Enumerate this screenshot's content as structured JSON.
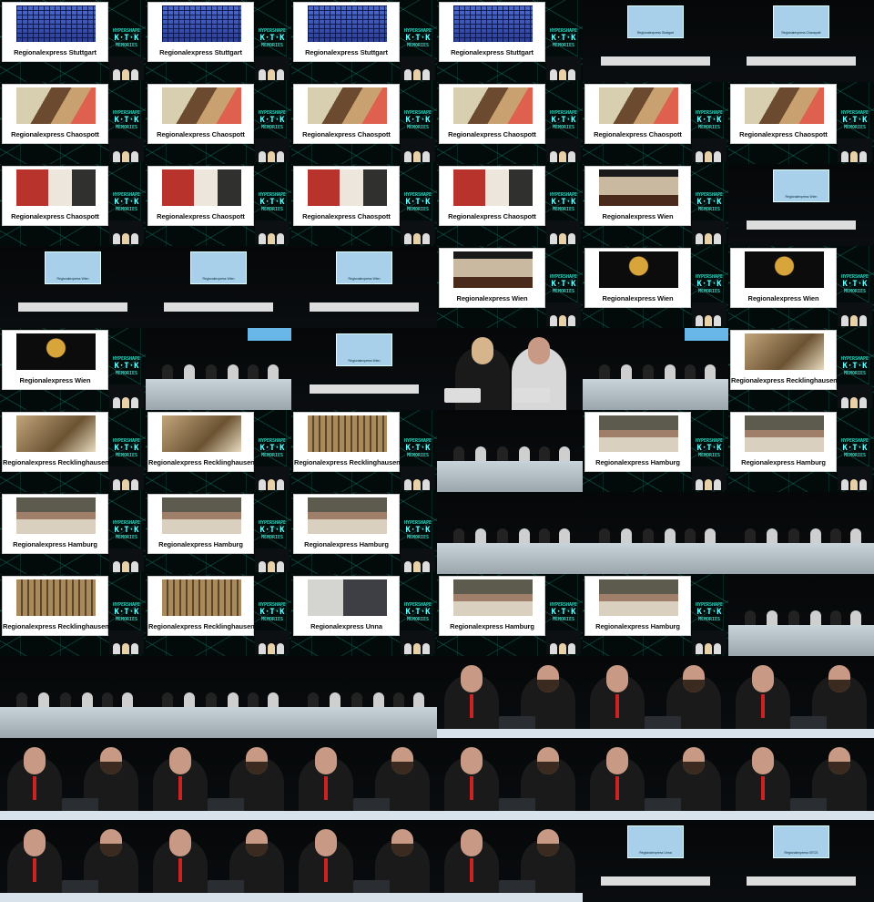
{
  "tiles": [
    {
      "type": "slide",
      "caption": "Regionalexpress Stuttgart",
      "pic": "building"
    },
    {
      "type": "slide",
      "caption": "Regionalexpress Stuttgart",
      "pic": "building"
    },
    {
      "type": "slide",
      "caption": "Regionalexpress Stuttgart",
      "pic": "building"
    },
    {
      "type": "slide",
      "caption": "Regionalexpress Stuttgart",
      "pic": "building"
    },
    {
      "type": "screen",
      "caption": "Regionalexpress Stuttgart"
    },
    {
      "type": "screen",
      "caption": "Regionalexpress Chaospott"
    },
    {
      "type": "slide",
      "caption": "Regionalexpress Chaospott",
      "pic": "desk"
    },
    {
      "type": "slide",
      "caption": "Regionalexpress Chaospott",
      "pic": "desk"
    },
    {
      "type": "slide",
      "caption": "Regionalexpress Chaospott",
      "pic": "desk"
    },
    {
      "type": "slide",
      "caption": "Regionalexpress Chaospott",
      "pic": "desk"
    },
    {
      "type": "slide",
      "caption": "Regionalexpress Chaospott",
      "pic": "desk"
    },
    {
      "type": "slide",
      "caption": "Regionalexpress Chaospott",
      "pic": "desk"
    },
    {
      "type": "slide",
      "caption": "Regionalexpress Chaospott",
      "pic": "hack"
    },
    {
      "type": "slide",
      "caption": "Regionalexpress Chaospott",
      "pic": "hack"
    },
    {
      "type": "slide",
      "caption": "Regionalexpress Chaospott",
      "pic": "hack"
    },
    {
      "type": "slide",
      "caption": "Regionalexpress Chaospott",
      "pic": "hack"
    },
    {
      "type": "slide",
      "caption": "Regionalexpress Wien",
      "pic": "hall"
    },
    {
      "type": "screen",
      "caption": "Regionalexpress Wien"
    },
    {
      "type": "screen",
      "caption": "Regionalexpress Wien"
    },
    {
      "type": "screen",
      "caption": "Regionalexpress Wien"
    },
    {
      "type": "screen",
      "caption": "Regionalexpress Wien"
    },
    {
      "type": "slide",
      "caption": "Regionalexpress Wien",
      "pic": "hall"
    },
    {
      "type": "slide",
      "caption": "Regionalexpress Wien",
      "pic": "gold"
    },
    {
      "type": "slide",
      "caption": "Regionalexpress Wien",
      "pic": "gold"
    },
    {
      "type": "slide",
      "caption": "Regionalexpress Wien",
      "pic": "gold"
    },
    {
      "type": "stage"
    },
    {
      "type": "screen",
      "caption": "Regionalexpress Wien"
    },
    {
      "type": "duo"
    },
    {
      "type": "stage"
    },
    {
      "type": "slide",
      "caption": "Regionalexpress Recklinghausen",
      "pic": "lab"
    },
    {
      "type": "slide",
      "caption": "Regionalexpress Recklinghausen",
      "pic": "lab"
    },
    {
      "type": "slide",
      "caption": "Regionalexpress Recklinghausen",
      "pic": "lab"
    },
    {
      "type": "slide",
      "caption": "Regionalexpress Recklinghausen",
      "pic": "shelf"
    },
    {
      "type": "stage"
    },
    {
      "type": "slide",
      "caption": "Regionalexpress Hamburg",
      "pic": "hamburg"
    },
    {
      "type": "slide",
      "caption": "Regionalexpress Hamburg",
      "pic": "hamburg"
    },
    {
      "type": "slide",
      "caption": "Regionalexpress Hamburg",
      "pic": "hamburg"
    },
    {
      "type": "slide",
      "caption": "Regionalexpress Hamburg",
      "pic": "hamburg"
    },
    {
      "type": "slide",
      "caption": "Regionalexpress Hamburg",
      "pic": "hamburg"
    },
    {
      "type": "stage"
    },
    {
      "type": "stage"
    },
    {
      "type": "stage"
    },
    {
      "type": "slide",
      "caption": "Regionalexpress Recklinghausen",
      "pic": "shelf"
    },
    {
      "type": "slide",
      "caption": "Regionalexpress Recklinghausen",
      "pic": "shelf"
    },
    {
      "type": "slide",
      "caption": "Regionalexpress Unna",
      "pic": "unna"
    },
    {
      "type": "slide",
      "caption": "Regionalexpress Hamburg",
      "pic": "hamburg"
    },
    {
      "type": "slide",
      "caption": "Regionalexpress Hamburg",
      "pic": "hamburg"
    },
    {
      "type": "stage"
    },
    {
      "type": "stage"
    },
    {
      "type": "stage"
    },
    {
      "type": "stage"
    },
    {
      "type": "closeup"
    },
    {
      "type": "closeup"
    },
    {
      "type": "closeup"
    },
    {
      "type": "closeup"
    },
    {
      "type": "closeup"
    },
    {
      "type": "closeup"
    },
    {
      "type": "closeup"
    },
    {
      "type": "closeup"
    },
    {
      "type": "closeup"
    },
    {
      "type": "closeup"
    },
    {
      "type": "closeup"
    },
    {
      "type": "closeup"
    },
    {
      "type": "closeup"
    },
    {
      "type": "screen",
      "caption": "Regionalexpress Unna"
    },
    {
      "type": "screen",
      "caption": "Regionalexpress OECS"
    }
  ],
  "logo": {
    "line1": "HYPERSHAPE",
    "line2": "K·T·K",
    "line3": "MEMORIES"
  }
}
